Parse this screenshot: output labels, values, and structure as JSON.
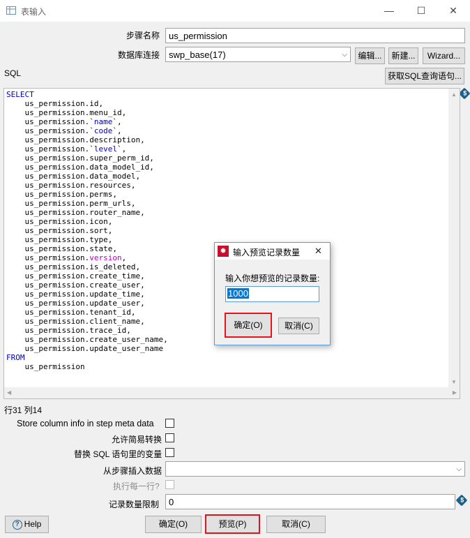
{
  "window": {
    "title": "表输入",
    "minimize": "—",
    "maximize": "☐",
    "close": "✕"
  },
  "form": {
    "step_name_label": "步骤名称",
    "step_name_value": "us_permission",
    "db_conn_label": "数据库连接",
    "db_conn_value": "swp_base(17)",
    "edit_btn": "编辑...",
    "new_btn": "新建...",
    "wizard_btn": "Wizard...",
    "sql_label": "SQL",
    "get_sql_btn": "获取SQL查询语句..."
  },
  "sql": {
    "select_kw": "SELECT",
    "fields": [
      "us_permission.id,",
      "us_permission.menu_id,",
      "us_permission.`name`,",
      "us_permission.`code`,",
      "us_permission.description,",
      "us_permission.`level`,",
      "us_permission.super_perm_id,",
      "us_permission.data_model_id,",
      "us_permission.data_model,",
      "us_permission.resources,",
      "us_permission.perms,",
      "us_permission.perm_urls,",
      "us_permission.router_name,",
      "us_permission.icon,",
      "us_permission.sort,",
      "us_permission.type,",
      "us_permission.state,",
      "us_permission.version,",
      "us_permission.is_deleted,",
      "us_permission.create_time,",
      "us_permission.create_user,",
      "us_permission.update_time,",
      "us_permission.update_user,",
      "us_permission.tenant_id,",
      "us_permission.client_name,",
      "us_permission.trace_id,",
      "us_permission.create_user_name,",
      "us_permission.update_user_name"
    ],
    "from_kw": "FROM",
    "table": "us_permission"
  },
  "status": {
    "cursor": "行31 列14"
  },
  "options": {
    "store_column_info": "Store column info in step meta data",
    "lazy_conversion": "允许简易转换",
    "replace_vars": "替换 SQL 语句里的变量",
    "insert_from_step": "从步骤插入数据",
    "execute_each_row": "执行每一行?",
    "limit_label": "记录数量限制",
    "limit_value": "0"
  },
  "buttons": {
    "help": "Help",
    "ok": "确定(O)",
    "preview": "预览(P)",
    "cancel": "取消(C)"
  },
  "dialog": {
    "title": "输入预览记录数量",
    "prompt": "输入你想预览的记录数量:",
    "value": "1000",
    "ok": "确定(O)",
    "cancel": "取消(C)",
    "close": "✕"
  }
}
